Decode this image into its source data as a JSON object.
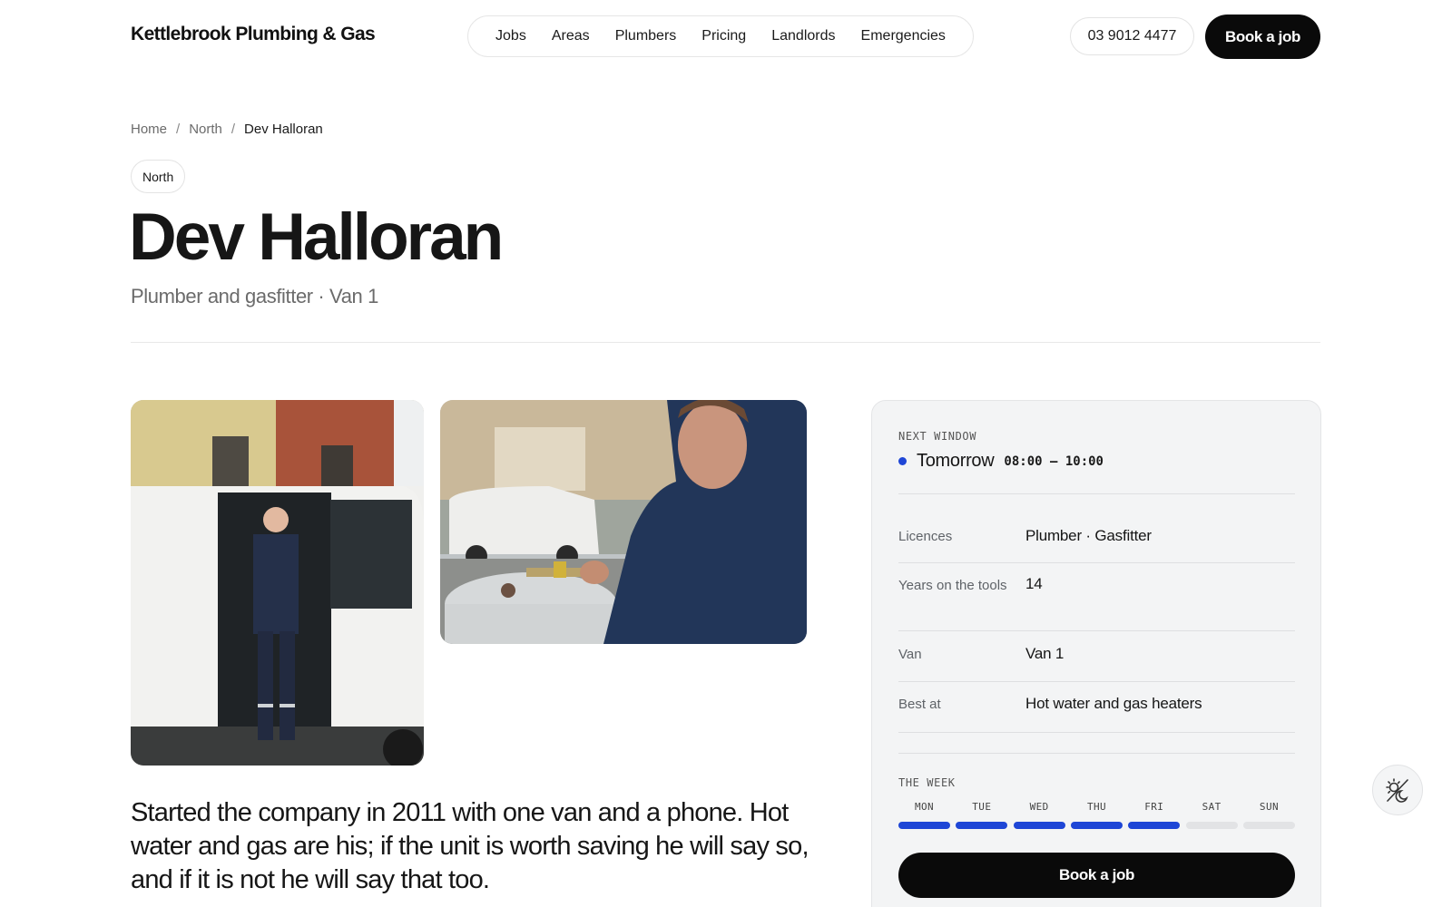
{
  "header": {
    "brand": "Kettlebrook Plumbing & Gas",
    "nav": [
      {
        "label": "Jobs"
      },
      {
        "label": "Areas"
      },
      {
        "label": "Plumbers"
      },
      {
        "label": "Pricing"
      },
      {
        "label": "Landlords"
      },
      {
        "label": "Emergencies"
      }
    ],
    "phone": "03 9012 4477",
    "book_label": "Book a job"
  },
  "breadcrumb": {
    "items": [
      "Home",
      "North",
      "Dev Halloran"
    ],
    "separator": "/"
  },
  "profile": {
    "region": "North",
    "name": "Dev Halloran",
    "subtitle": "Plumber and gasfitter · Van 1",
    "bio": "Started the company in 2011 with one van and a phone. Hot water and gas are his; if the unit is worth saving he will say so, and if it is not he will say that too.",
    "photos": [
      {
        "icon": "photo-plumber-by-van"
      },
      {
        "icon": "photo-plumber-fitting-gas-valve"
      }
    ]
  },
  "card": {
    "next_window_label": "NEXT WINDOW",
    "next_window_day": "Tomorrow",
    "next_window_time": "08:00 – 10:00",
    "status_color": "#1e46d6",
    "specs": [
      {
        "label": "Licences",
        "value": "Plumber · Gasfitter"
      },
      {
        "label": "Years on the tools",
        "value": "14"
      },
      {
        "label": "Van",
        "value": "Van 1"
      },
      {
        "label": "Best at",
        "value": "Hot water and gas heaters"
      }
    ],
    "week_label": "THE WEEK",
    "week": [
      {
        "day": "MON",
        "busy": true
      },
      {
        "day": "TUE",
        "busy": true
      },
      {
        "day": "WED",
        "busy": true
      },
      {
        "day": "THU",
        "busy": true
      },
      {
        "day": "FRI",
        "busy": true
      },
      {
        "day": "SAT",
        "busy": false
      },
      {
        "day": "SUN",
        "busy": false
      }
    ],
    "book_label": "Book a job"
  },
  "fab": {
    "icon": "theme-toggle-icon"
  },
  "colors": {
    "accent": "#1e46d6",
    "button": "#0a0a0a",
    "card_bg": "#f3f4f5"
  }
}
